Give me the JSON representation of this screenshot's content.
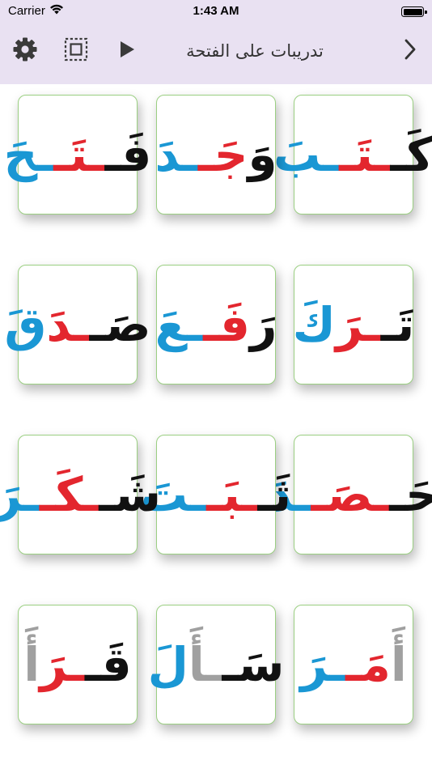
{
  "status_bar": {
    "carrier": "Carrier",
    "time": "1:43 AM",
    "icons": [
      "wifi-icon",
      "battery-icon"
    ]
  },
  "nav_bar": {
    "title": "تدريبات على الفتحة",
    "icons": [
      "gear-icon",
      "select-all-icon",
      "play-icon",
      "chevron-right-icon"
    ]
  },
  "colors": {
    "bar_background": "#e9e1f2",
    "card_border": "#9bcf82",
    "letter_black": "#111111",
    "letter_red": "#e3262e",
    "letter_blue": "#1a97d4",
    "letter_gray": "#a0a0a0"
  },
  "cards": [
    {
      "word": "كَتَبَ",
      "segments": [
        {
          "text": "كَـ",
          "color": "black"
        },
        {
          "text": "ـتَـ",
          "color": "red"
        },
        {
          "text": "ـبَ",
          "color": "blue"
        }
      ]
    },
    {
      "word": "وَجَدَ",
      "segments": [
        {
          "text": "وَ",
          "color": "black"
        },
        {
          "text": "جَـ",
          "color": "red"
        },
        {
          "text": "ـدَ",
          "color": "blue"
        }
      ]
    },
    {
      "word": "فَتَحَ",
      "segments": [
        {
          "text": "فَـ",
          "color": "black"
        },
        {
          "text": "ـتَـ",
          "color": "red"
        },
        {
          "text": "ـحَ",
          "color": "blue"
        }
      ]
    },
    {
      "word": "تَرَكَ",
      "segments": [
        {
          "text": "تَـ",
          "color": "black"
        },
        {
          "text": "ـرَ",
          "color": "red"
        },
        {
          "text": "كَ",
          "color": "blue"
        }
      ]
    },
    {
      "word": "رَفَعَ",
      "segments": [
        {
          "text": "رَ",
          "color": "black"
        },
        {
          "text": "فَـ",
          "color": "red"
        },
        {
          "text": "ـعَ",
          "color": "blue"
        }
      ]
    },
    {
      "word": "صَدَقَ",
      "segments": [
        {
          "text": "صَـ",
          "color": "black"
        },
        {
          "text": "ـدَ",
          "color": "red"
        },
        {
          "text": "قَ",
          "color": "blue"
        }
      ]
    },
    {
      "word": "حَصَدَ",
      "segments": [
        {
          "text": "حَـ",
          "color": "black"
        },
        {
          "text": "ـصَـ",
          "color": "red"
        },
        {
          "text": "ـدَ",
          "color": "blue"
        }
      ]
    },
    {
      "word": "ثَبَتَ",
      "segments": [
        {
          "text": "ثَـ",
          "color": "black"
        },
        {
          "text": "ـبَـ",
          "color": "red"
        },
        {
          "text": "ـتَ",
          "color": "blue"
        }
      ]
    },
    {
      "word": "شَكَرَ",
      "segments": [
        {
          "text": "شَـ",
          "color": "black"
        },
        {
          "text": "ـكَـ",
          "color": "red"
        },
        {
          "text": "ـرَ",
          "color": "blue"
        }
      ]
    },
    {
      "word": "أَمَرَ",
      "segments": [
        {
          "text": "أَ",
          "color": "gray"
        },
        {
          "text": "مَـ",
          "color": "red"
        },
        {
          "text": "ـرَ",
          "color": "blue"
        }
      ]
    },
    {
      "word": "سَأَلَ",
      "segments": [
        {
          "text": "سَـ",
          "color": "black"
        },
        {
          "text": "ـأَ",
          "color": "gray"
        },
        {
          "text": "لَ",
          "color": "blue"
        }
      ]
    },
    {
      "word": "قَرَأَ",
      "segments": [
        {
          "text": "قَـ",
          "color": "black"
        },
        {
          "text": "ـرَ",
          "color": "red"
        },
        {
          "text": "أَ",
          "color": "gray"
        }
      ]
    }
  ]
}
